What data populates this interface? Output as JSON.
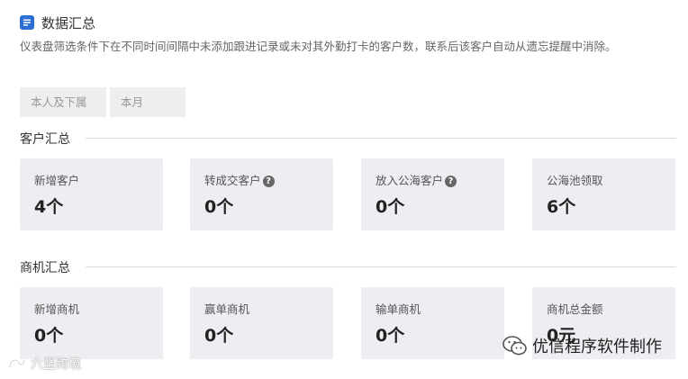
{
  "header": {
    "title": "数据汇总",
    "icon": "dashboard-icon"
  },
  "description": "仪表盘筛选条件下在不同时间间隔中未添加跟进记录或未对其外勤打卡的客户数，联系后该客户自动从遗忘提醒中消除。",
  "filters": [
    {
      "value": "本人及下属"
    },
    {
      "value": "本月"
    }
  ],
  "customer_section": {
    "title": "客户汇总",
    "cards": [
      {
        "label": "新增客户",
        "value": "4个",
        "help": false
      },
      {
        "label": "转成交客户",
        "value": "0个",
        "help": true
      },
      {
        "label": "放入公海客户",
        "value": "0个",
        "help": true
      },
      {
        "label": "公海池领取",
        "value": "6个",
        "help": false
      }
    ]
  },
  "opportunity_section": {
    "title": "商机汇总",
    "cards": [
      {
        "label": "新增商机",
        "value": "0个"
      },
      {
        "label": "赢单商机",
        "value": "0个"
      },
      {
        "label": "输单商机",
        "value": "0个"
      },
      {
        "label": "商机总金额",
        "value": "0元"
      }
    ]
  },
  "watermarks": {
    "right": "优信程序软件制作",
    "left": "六竖跨境"
  },
  "colors": {
    "accent": "#2b6fd6",
    "card_bg": "#eceef1"
  }
}
